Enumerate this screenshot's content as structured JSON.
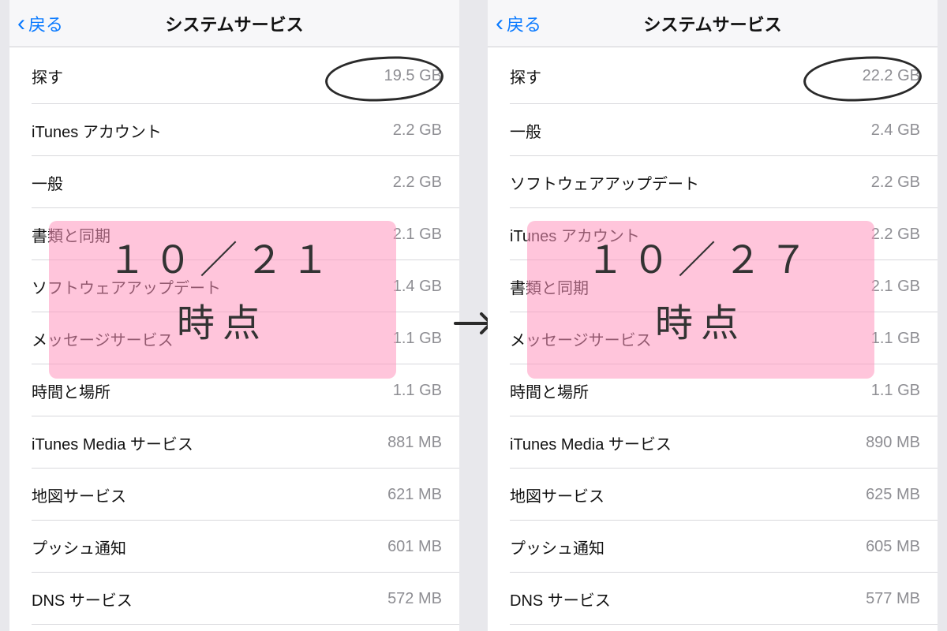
{
  "left": {
    "back_label": "戻る",
    "title": "システムサービス",
    "annotation": {
      "line1": "１０／２１",
      "line2": "時点"
    },
    "rows": [
      {
        "label": "探す",
        "value": "19.5 GB"
      },
      {
        "label": "iTunes アカウント",
        "value": "2.2 GB"
      },
      {
        "label": "一般",
        "value": "2.2 GB"
      },
      {
        "label": "書類と同期",
        "value": "2.1 GB"
      },
      {
        "label": "ソフトウェアアップデート",
        "value": "1.4 GB"
      },
      {
        "label": "メッセージサービス",
        "value": "1.1 GB"
      },
      {
        "label": "時間と場所",
        "value": "1.1 GB"
      },
      {
        "label": "iTunes Media サービス",
        "value": "881 MB"
      },
      {
        "label": "地図サービス",
        "value": "621 MB"
      },
      {
        "label": "プッシュ通知",
        "value": "601 MB"
      },
      {
        "label": "DNS サービス",
        "value": "572 MB"
      }
    ]
  },
  "right": {
    "back_label": "戻る",
    "title": "システムサービス",
    "annotation": {
      "line1": "１０／２７",
      "line2": "時点"
    },
    "rows": [
      {
        "label": "探す",
        "value": "22.2 GB"
      },
      {
        "label": "一般",
        "value": "2.4 GB"
      },
      {
        "label": "ソフトウェアアップデート",
        "value": "2.2 GB"
      },
      {
        "label": "iTunes アカウント",
        "value": "2.2 GB"
      },
      {
        "label": "書類と同期",
        "value": "2.1 GB"
      },
      {
        "label": "メッセージサービス",
        "value": "1.1 GB"
      },
      {
        "label": "時間と場所",
        "value": "1.1 GB"
      },
      {
        "label": "iTunes Media サービス",
        "value": "890 MB"
      },
      {
        "label": "地図サービス",
        "value": "625 MB"
      },
      {
        "label": "プッシュ通知",
        "value": "605 MB"
      },
      {
        "label": "DNS サービス",
        "value": "577 MB"
      }
    ]
  }
}
